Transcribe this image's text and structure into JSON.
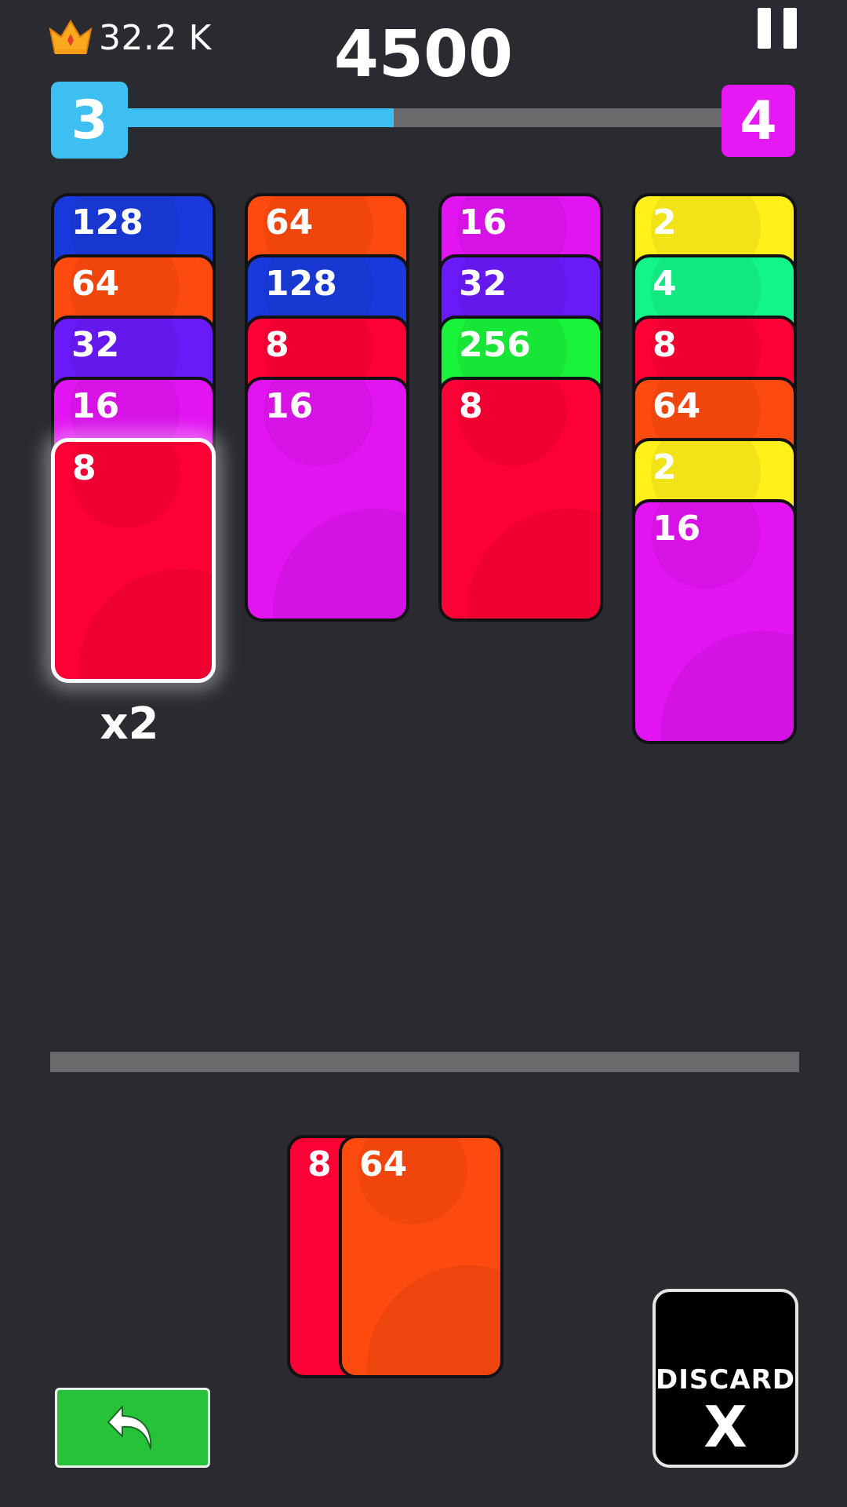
{
  "header": {
    "best_score": "32.2 K",
    "score": "4500",
    "crown_icon": "crown-icon",
    "pause_icon": "pause-icon"
  },
  "progress": {
    "current_level": "3",
    "next_level": "4",
    "fill_fraction": 0.45,
    "current_color": "#3dbff2",
    "next_color": "#e619f5"
  },
  "colors": {
    "2": "#fff01a",
    "4": "#13f58a",
    "8": "#fd0035",
    "16": "#e214f2",
    "32": "#6a1af8",
    "64": "#fd4a0f",
    "128": "#1a39dc",
    "256": "#19f33a"
  },
  "columns": [
    {
      "cards": [
        "128",
        "64",
        "32",
        "16",
        "8"
      ],
      "selected": true,
      "multiplier": "x2"
    },
    {
      "cards": [
        "64",
        "128",
        "8",
        "16"
      ]
    },
    {
      "cards": [
        "16",
        "32",
        "256",
        "8"
      ]
    },
    {
      "cards": [
        "2",
        "4",
        "8",
        "64",
        "2",
        "16"
      ]
    }
  ],
  "hand": {
    "back_card": "8",
    "front_card": "64"
  },
  "controls": {
    "undo_icon": "undo-arrow-icon",
    "discard_label": "DISCARD",
    "discard_symbol": "X"
  }
}
